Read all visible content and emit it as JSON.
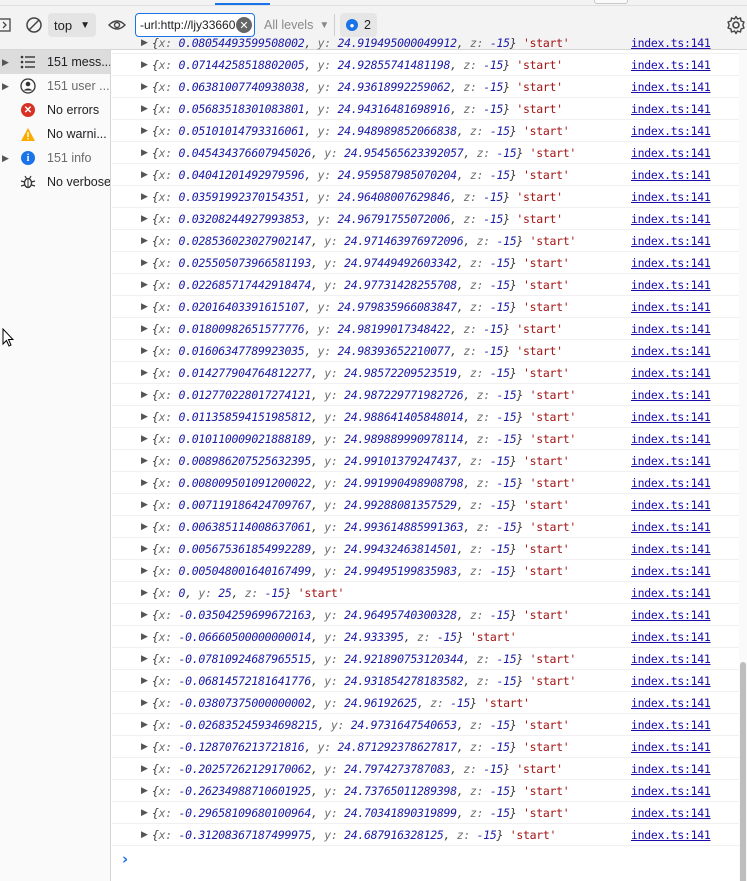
{
  "toolbar": {
    "context": "top",
    "filter_value": "-url:http://ljy33660",
    "levels_label": "All levels",
    "issues_count": "2"
  },
  "sidebar": {
    "items": [
      {
        "label": "151 mess...",
        "icon": "list-icon",
        "expandable": true,
        "selected": true
      },
      {
        "label": "151 user ...",
        "icon": "user-icon",
        "expandable": true,
        "selected": false
      },
      {
        "label": "No errors",
        "icon": "error-icon",
        "expandable": false,
        "selected": false
      },
      {
        "label": "No warni...",
        "icon": "warning-icon",
        "expandable": false,
        "selected": false
      },
      {
        "label": "151 info",
        "icon": "info-icon",
        "expandable": true,
        "selected": false
      },
      {
        "label": "No verbose",
        "icon": "bug-icon",
        "expandable": false,
        "selected": false
      }
    ]
  },
  "console": {
    "source": "index.ts:141",
    "tag": "'start'",
    "rows": [
      {
        "x": "0.08054493599508002",
        "y": "24.919495000049912",
        "z": "-15"
      },
      {
        "x": "0.07144258518802005",
        "y": "24.92855741481198",
        "z": "-15"
      },
      {
        "x": "0.06381007740938038",
        "y": "24.93618992259062",
        "z": "-15"
      },
      {
        "x": "0.05683518301083801",
        "y": "24.94316481698916",
        "z": "-15"
      },
      {
        "x": "0.05101014793316061",
        "y": "24.948989852066838",
        "z": "-15"
      },
      {
        "x": "0.045434376607945026",
        "y": "24.954565623392057",
        "z": "-15"
      },
      {
        "x": "0.04041201492979596",
        "y": "24.959587985070204",
        "z": "-15"
      },
      {
        "x": "0.03591992370154351",
        "y": "24.96408007629846",
        "z": "-15"
      },
      {
        "x": "0.03208244927993853",
        "y": "24.96791755072006",
        "z": "-15"
      },
      {
        "x": "0.028536023027902147",
        "y": "24.971463976972096",
        "z": "-15"
      },
      {
        "x": "0.025505073966581193",
        "y": "24.97449492603342",
        "z": "-15"
      },
      {
        "x": "0.022685717442918474",
        "y": "24.97731428255708",
        "z": "-15"
      },
      {
        "x": "0.02016403391615107",
        "y": "24.979835966083847",
        "z": "-15"
      },
      {
        "x": "0.01800982651577776",
        "y": "24.98199017348422",
        "z": "-15"
      },
      {
        "x": "0.01606347789923035",
        "y": "24.98393652210077",
        "z": "-15"
      },
      {
        "x": "0.014277904764812277",
        "y": "24.98572209523519",
        "z": "-15"
      },
      {
        "x": "0.012770228017274121",
        "y": "24.987229771982726",
        "z": "-15"
      },
      {
        "x": "0.011358594151985812",
        "y": "24.988641405848014",
        "z": "-15"
      },
      {
        "x": "0.010110009021888189",
        "y": "24.989889990978114",
        "z": "-15"
      },
      {
        "x": "0.008986207525632395",
        "y": "24.99101379247437",
        "z": "-15"
      },
      {
        "x": "0.008009501091200022",
        "y": "24.991990498908798",
        "z": "-15"
      },
      {
        "x": "0.007119186424709767",
        "y": "24.99288081357529",
        "z": "-15"
      },
      {
        "x": "0.006385114008637061",
        "y": "24.993614885991363",
        "z": "-15"
      },
      {
        "x": "0.005675361854992289",
        "y": "24.99432463814501",
        "z": "-15"
      },
      {
        "x": "0.005048001640167499",
        "y": "24.99495199835983",
        "z": "-15"
      },
      {
        "x": "0",
        "y": "25",
        "z": "-15"
      },
      {
        "x": "-0.03504259699672163",
        "y": "24.96495740300328",
        "z": "-15"
      },
      {
        "x": "-0.06660500000000014",
        "y": "24.933395",
        "z": "-15"
      },
      {
        "x": "-0.07810924687965515",
        "y": "24.921890753120344",
        "z": "-15"
      },
      {
        "x": "-0.06814572181641776",
        "y": "24.931854278183582",
        "z": "-15"
      },
      {
        "x": "-0.03807375000000002",
        "y": "24.96192625",
        "z": "-15"
      },
      {
        "x": "-0.026835245934698215",
        "y": "24.9731647540653",
        "z": "-15"
      },
      {
        "x": "-0.1287076213721816",
        "y": "24.871292378627817",
        "z": "-15"
      },
      {
        "x": "-0.20257262129170062",
        "y": "24.7974273787083",
        "z": "-15"
      },
      {
        "x": "-0.26234988710601925",
        "y": "24.73765011289398",
        "z": "-15"
      },
      {
        "x": "-0.29658109680100964",
        "y": "24.70341890319899",
        "z": "-15"
      },
      {
        "x": "-0.31208367187499975",
        "y": "24.687916328125",
        "z": "-15"
      }
    ]
  },
  "colors": {
    "accent": "#1a73e8",
    "error": "#d93025",
    "warning": "#f9ab00",
    "number": "#1a1aa6",
    "string": "#a31515",
    "link": "#1a0dab"
  }
}
